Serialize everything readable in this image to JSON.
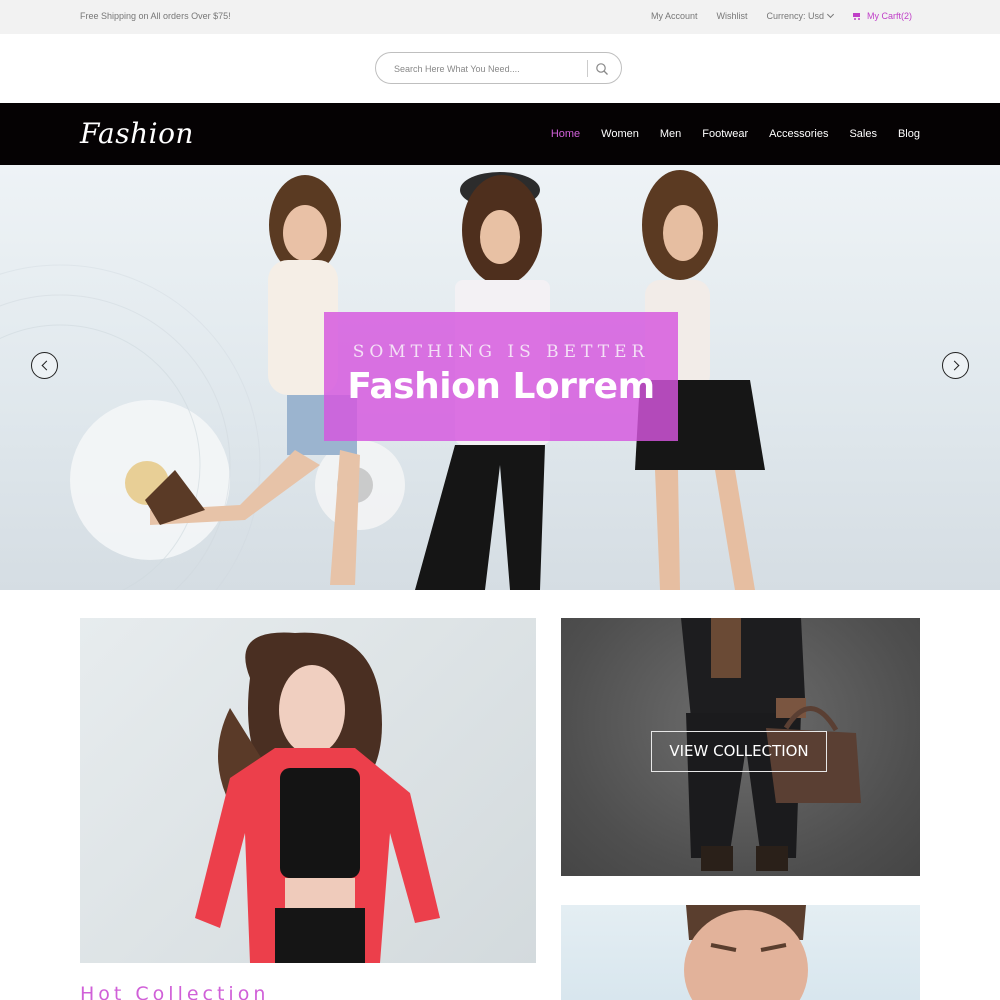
{
  "topbar": {
    "shipping_text": "Free Shipping on All orders Over $75!",
    "my_account": "My Account",
    "wishlist": "Wishlist",
    "currency": "Currency: Usd",
    "cart": "My Carft(2)"
  },
  "search": {
    "placeholder": "Search Here What You Need...."
  },
  "nav": {
    "logo": "Fashion",
    "items": [
      {
        "label": "Home",
        "active": true
      },
      {
        "label": "Women"
      },
      {
        "label": "Men"
      },
      {
        "label": "Footwear"
      },
      {
        "label": "Accessories"
      },
      {
        "label": "Sales"
      },
      {
        "label": "Blog"
      }
    ]
  },
  "hero": {
    "subtitle": "SOMTHING IS BETTER",
    "title": "Fashion Lorrem"
  },
  "collections": {
    "view_button": "VIEW COLLECTION",
    "hot_title": "Hot Collection"
  },
  "colors": {
    "accent": "#d060d8",
    "nav_bg": "#050203",
    "topbar_bg": "#f2f2f2"
  }
}
